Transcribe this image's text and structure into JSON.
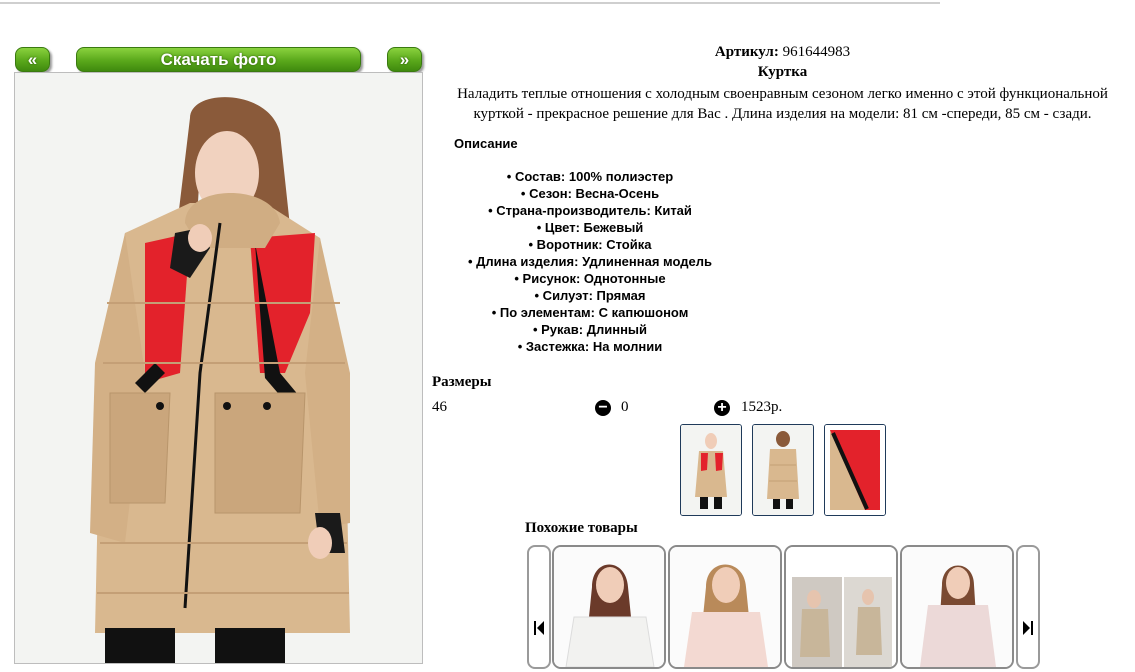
{
  "nav": {
    "prev_label": "«",
    "download_label": "Скачать фото",
    "next_label": "»"
  },
  "product": {
    "article_label": "Артикул:",
    "article_value": "961644983",
    "name": "Куртка",
    "description": "Наладить теплые отношения с холодным своенравным сезоном легко именно с этой функциональной курткой - прекрасное решение для Вас . Длина изделия на модели: 81 см -спереди, 85 см - сзади.",
    "description_heading": "Описание",
    "specs": [
      "• Состав: 100% полиэстер",
      "• Сезон: Весна-Осень",
      "• Страна-производитель: Китай",
      "• Цвет: Бежевый",
      "• Воротник: Стойка",
      "• Длина изделия: Удлиненная модель",
      "• Рисунок: Однотонные",
      "• Силуэт: Прямая",
      "• По элементам: С капюшоном",
      "• Рукав: Длинный",
      "• Застежка: На молнии"
    ]
  },
  "sizes": {
    "title": "Размеры",
    "size": "46",
    "quantity": "0",
    "price": "1523р."
  },
  "similar": {
    "title": "Похожие товары"
  },
  "colors": {
    "jacket": "#d9b88f",
    "accent_red": "#e3222b",
    "button_green": "#5aa81b"
  }
}
